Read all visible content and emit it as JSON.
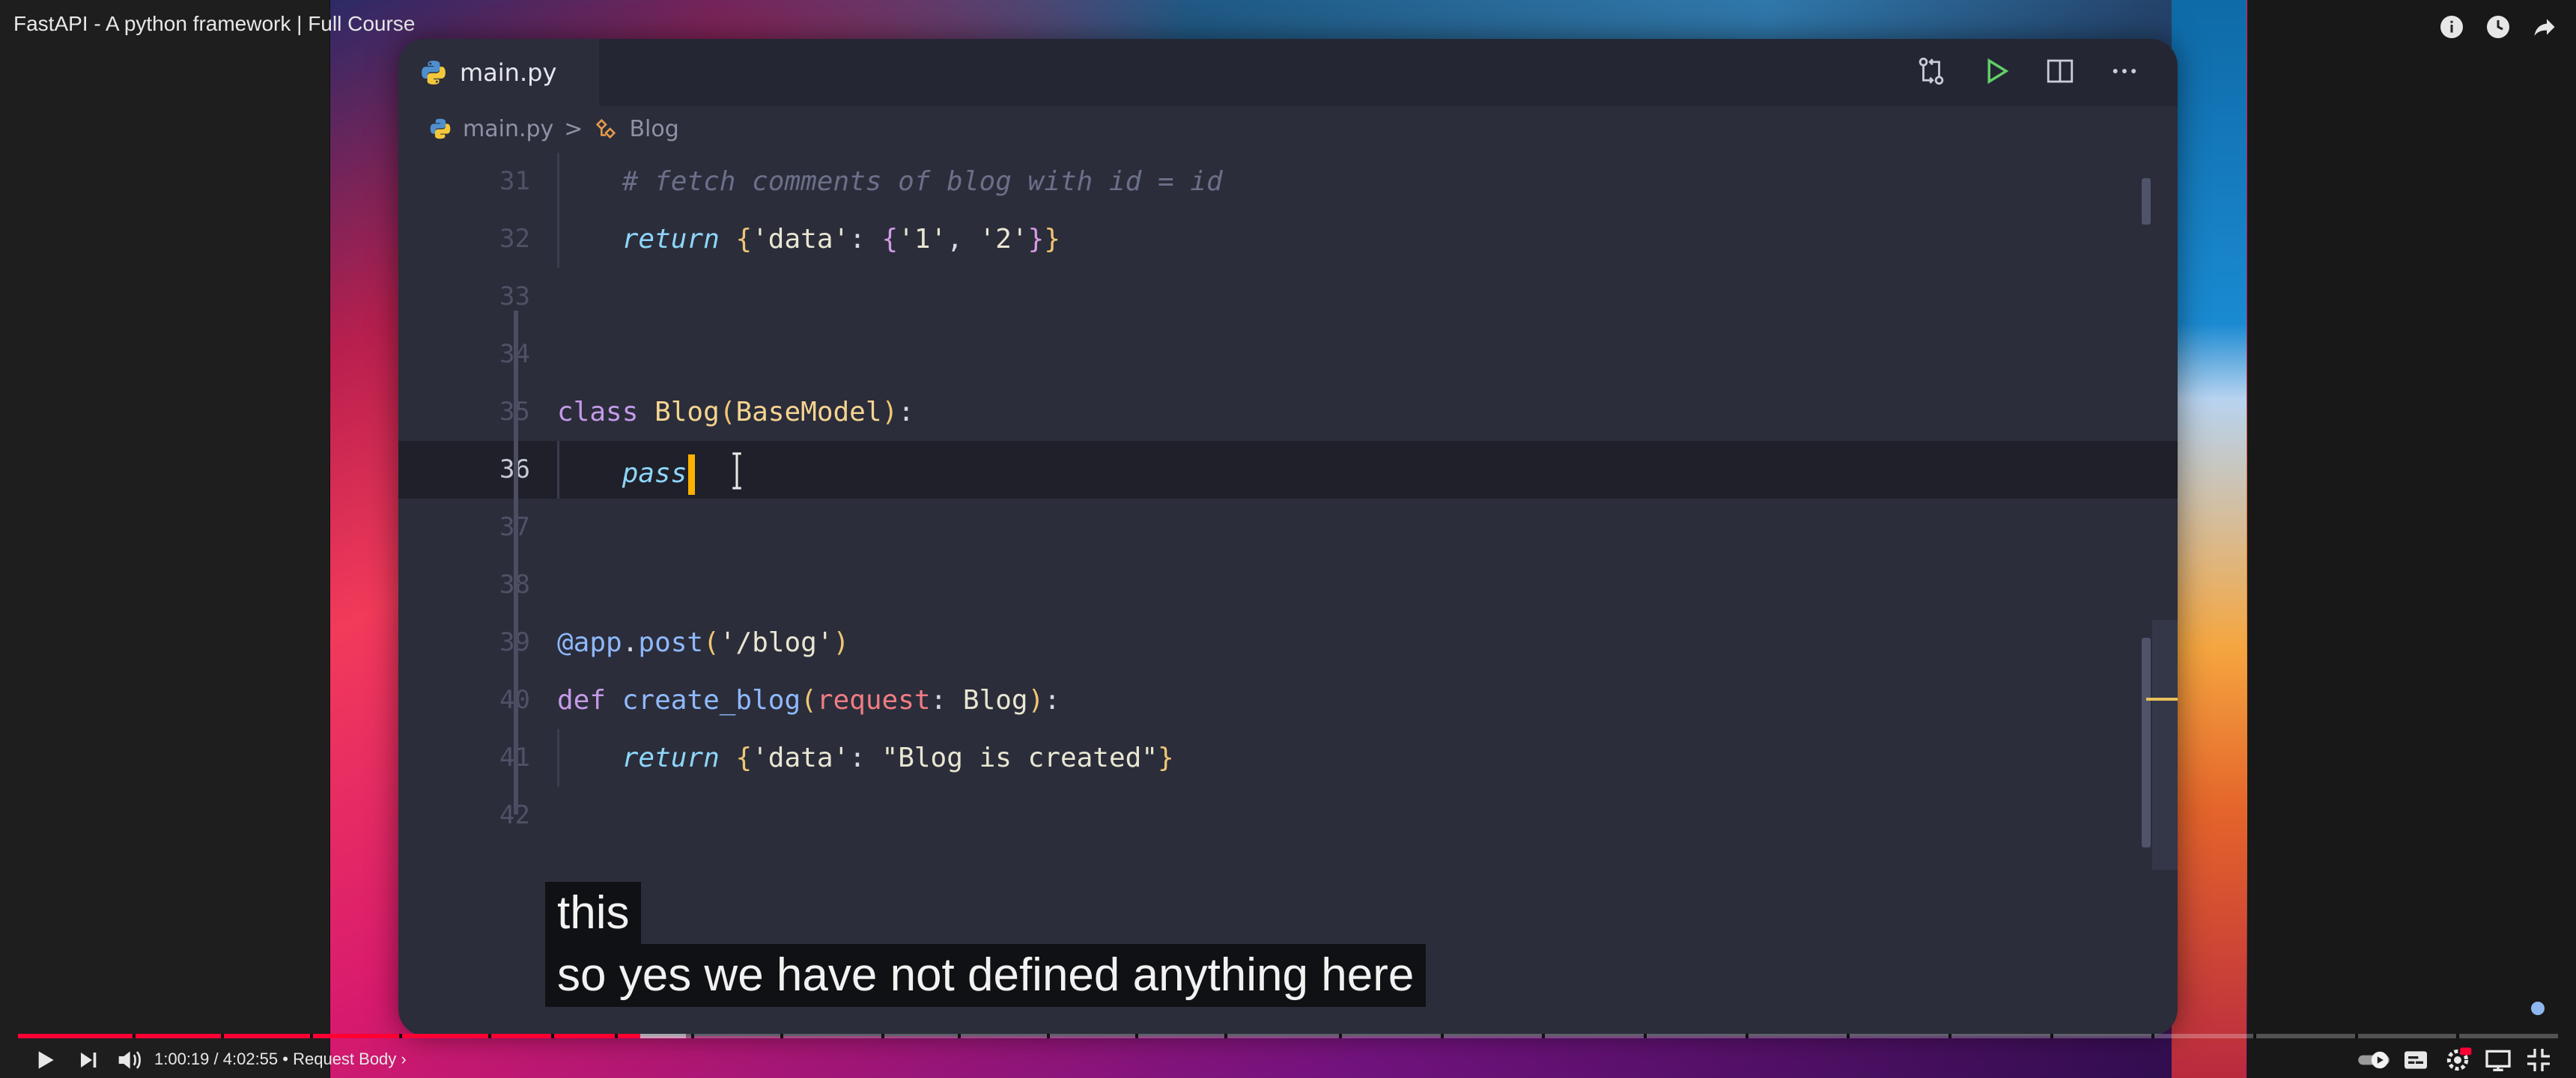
{
  "video": {
    "title": "FastAPI - A python framework | Full Course",
    "time_current": "1:00:19",
    "time_separator": " / ",
    "time_total": "4:02:55",
    "chapter": "Request Body",
    "chapter_separator": " • ",
    "chapter_arrow": "›",
    "progress_fraction": 0.245
  },
  "editor": {
    "tab_label": "main.py",
    "breadcrumb": {
      "file": "main.py",
      "separator": ">",
      "symbol": "Blog"
    },
    "lines": [
      {
        "n": "31",
        "parts": [
          [
            "    ",
            ""
          ],
          [
            "# fetch comments of blog with id = id",
            "comment"
          ]
        ]
      },
      {
        "n": "32",
        "parts": [
          [
            "    ",
            ""
          ],
          [
            "return",
            "kwi"
          ],
          [
            " ",
            ""
          ],
          [
            "{",
            "brace1"
          ],
          [
            "'data'",
            "str"
          ],
          [
            ": ",
            ""
          ],
          [
            "{",
            "brace2"
          ],
          [
            "'1'",
            "str"
          ],
          [
            ", ",
            ""
          ],
          [
            "'2'",
            "str"
          ],
          [
            "}",
            "brace2"
          ],
          [
            "}",
            "brace1"
          ]
        ]
      },
      {
        "n": "33",
        "parts": []
      },
      {
        "n": "34",
        "parts": []
      },
      {
        "n": "35",
        "parts": [
          [
            "class",
            "kw"
          ],
          [
            " ",
            ""
          ],
          [
            "Blog",
            "cls"
          ],
          [
            "(",
            "brace1"
          ],
          [
            "BaseModel",
            "cls"
          ],
          [
            ")",
            "brace1"
          ],
          [
            ":",
            ""
          ]
        ]
      },
      {
        "n": "36",
        "parts": [
          [
            "    ",
            ""
          ],
          [
            "pass",
            "kwi"
          ]
        ],
        "active": true
      },
      {
        "n": "37",
        "parts": []
      },
      {
        "n": "38",
        "parts": []
      },
      {
        "n": "39",
        "parts": [
          [
            "@app",
            "fn"
          ],
          [
            ".",
            ""
          ],
          [
            "post",
            "fn"
          ],
          [
            "(",
            "brace1"
          ],
          [
            "'/blog'",
            "str"
          ],
          [
            ")",
            "brace1"
          ]
        ]
      },
      {
        "n": "40",
        "parts": [
          [
            "def",
            "kw"
          ],
          [
            " ",
            ""
          ],
          [
            "create_blog",
            "fn"
          ],
          [
            "(",
            "brace1"
          ],
          [
            "request",
            "param"
          ],
          [
            ": ",
            ""
          ],
          [
            "Blog",
            "str"
          ],
          [
            ")",
            "brace1"
          ],
          [
            ":",
            ""
          ]
        ]
      },
      {
        "n": "41",
        "parts": [
          [
            "    ",
            ""
          ],
          [
            "return",
            "kwi"
          ],
          [
            " ",
            ""
          ],
          [
            "{",
            "brace1"
          ],
          [
            "'data'",
            "str"
          ],
          [
            ": ",
            ""
          ],
          [
            "\"Blog is created\"",
            "str"
          ],
          [
            "}",
            "brace1"
          ]
        ]
      },
      {
        "n": "42",
        "parts": []
      }
    ]
  },
  "captions": {
    "line1": "this",
    "line2": "so yes we have not defined anything here"
  },
  "icons": {
    "top": [
      "info-icon",
      "clock-icon",
      "share-icon"
    ],
    "actions": [
      "compare-changes-icon",
      "run-icon",
      "split-editor-icon",
      "more-icon"
    ],
    "controls_left": [
      "play-icon",
      "next-icon",
      "volume-icon"
    ],
    "controls_right": [
      "autoplay-toggle-icon",
      "subtitles-icon",
      "settings-icon",
      "miniplayer-icon",
      "exit-fullscreen-icon"
    ]
  },
  "colors": {
    "progress": "#ff0033",
    "cursor": "#ffb000",
    "accent_run": "#5fd068"
  }
}
